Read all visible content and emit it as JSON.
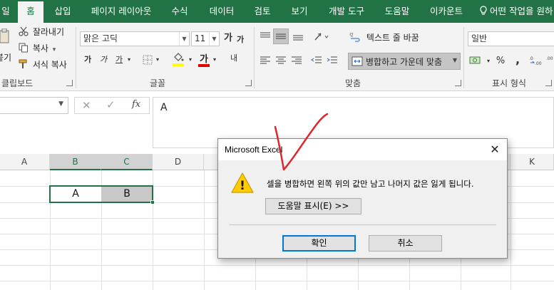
{
  "tabs": [
    {
      "label": "일",
      "active": false
    },
    {
      "label": "홈",
      "active": true
    },
    {
      "label": "삽입",
      "active": false
    },
    {
      "label": "페이지 레이아웃",
      "active": false
    },
    {
      "label": "수식",
      "active": false
    },
    {
      "label": "데이터",
      "active": false
    },
    {
      "label": "검토",
      "active": false
    },
    {
      "label": "보기",
      "active": false
    },
    {
      "label": "개발 도구",
      "active": false
    },
    {
      "label": "도움말",
      "active": false
    },
    {
      "label": "이카운트",
      "active": false
    }
  ],
  "tell_me": "어떤 작업을 원하",
  "clipboard": {
    "paste_label": "붙기",
    "cut_label": "잘라내기",
    "copy_label": "복사",
    "copy_arrow": "▾",
    "format_painter_label": "서식 복사",
    "group_label": "클립보드"
  },
  "font": {
    "font_name": "맑은 고딕",
    "font_size": "11",
    "grow_font": "가",
    "shrink_font": "가",
    "bold": "가",
    "italic": "가",
    "underline": "가",
    "font_color_glyph": "가",
    "phonetic_glyph": "내",
    "group_label": "글꼴",
    "fill_color": "#FFFF00",
    "font_color": "#E00000"
  },
  "alignment": {
    "wrap_text_label": "텍스트 줄 바꿈",
    "merge_center_label": "병합하고 가운데 맞춤",
    "group_label": "맞춤"
  },
  "number": {
    "format_value": "일반",
    "percent": "%",
    "comma": ",",
    "group_label": "표시 형식"
  },
  "formula_bar": {
    "name_box": "",
    "cancel": "✕",
    "enter": "✓",
    "fx": "fx",
    "content": "A"
  },
  "grid": {
    "columns": [
      "A",
      "B",
      "C",
      "D",
      "K"
    ],
    "cell_b": "A",
    "cell_c": "B"
  },
  "dialog": {
    "title": "Microsoft Excel",
    "message": "셀을 병합하면 왼쪽 위의 값만 남고 나머지 값은 잃게 됩니다.",
    "help_button": "도움말 표시(E) >>",
    "ok_button": "확인",
    "cancel_button": "취소",
    "close_glyph": "✕",
    "warning_glyph": "!"
  },
  "colors": {
    "brand": "#217346",
    "ribbon_bg": "#F3F3F3",
    "warning": "#FFCC00",
    "annotation": "#E0262D"
  },
  "icons": {
    "paste": "paste-icon",
    "cut": "scissors-icon",
    "copy": "copy-icon",
    "format_painter": "format-painter-icon",
    "warning": "warning-icon",
    "tell_me": "lightbulb-icon"
  }
}
